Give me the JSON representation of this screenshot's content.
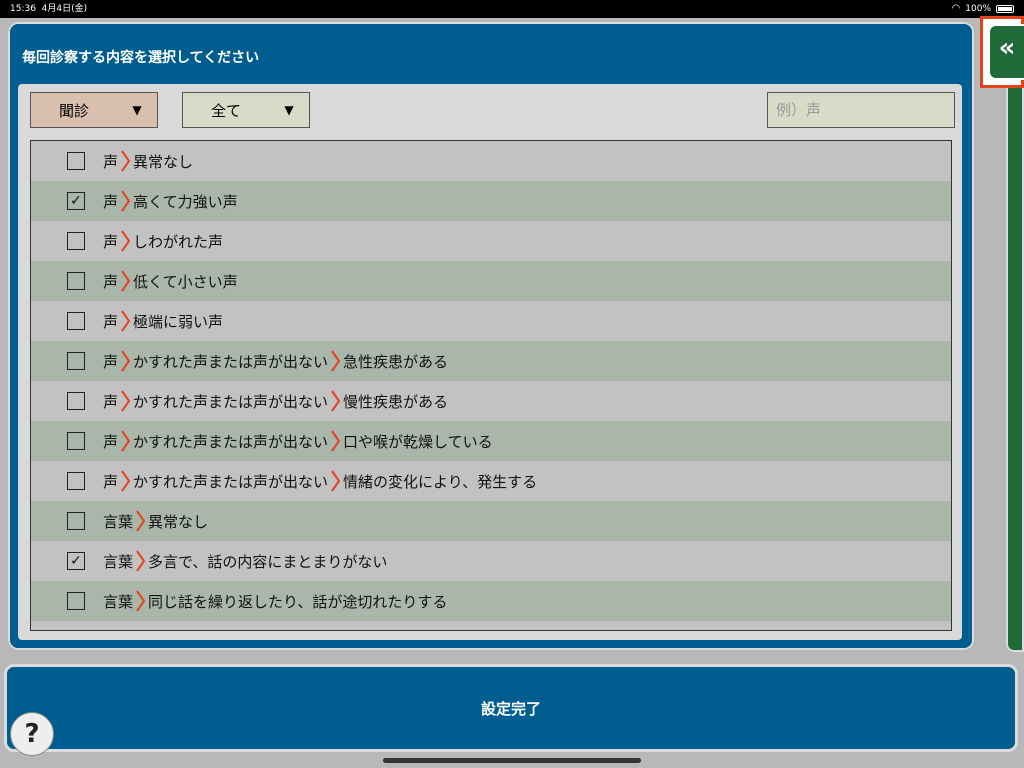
{
  "status": {
    "time": "15:36",
    "date": "4月4日(金)",
    "battery": "100%"
  },
  "panel": {
    "title": "毎回診察する内容を選択してください",
    "category_filter": "聞診",
    "scope_filter": "全て",
    "search_placeholder": "例）声"
  },
  "rows": [
    {
      "checked": false,
      "parts": [
        "声",
        "異常なし"
      ]
    },
    {
      "checked": true,
      "parts": [
        "声",
        "高くて力強い声"
      ]
    },
    {
      "checked": false,
      "parts": [
        "声",
        "しわがれた声"
      ]
    },
    {
      "checked": false,
      "parts": [
        "声",
        "低くて小さい声"
      ]
    },
    {
      "checked": false,
      "parts": [
        "声",
        "極端に弱い声"
      ]
    },
    {
      "checked": false,
      "parts": [
        "声",
        "かすれた声または声が出ない",
        "急性疾患がある"
      ]
    },
    {
      "checked": false,
      "parts": [
        "声",
        "かすれた声または声が出ない",
        "慢性疾患がある"
      ]
    },
    {
      "checked": false,
      "parts": [
        "声",
        "かすれた声または声が出ない",
        "口や喉が乾燥している"
      ]
    },
    {
      "checked": false,
      "parts": [
        "声",
        "かすれた声または声が出ない",
        "情緒の変化により、発生する"
      ]
    },
    {
      "checked": false,
      "parts": [
        "言葉",
        "異常なし"
      ]
    },
    {
      "checked": true,
      "parts": [
        "言葉",
        "多言で、話の内容にまとまりがない"
      ]
    },
    {
      "checked": false,
      "parts": [
        "言葉",
        "同じ話を繰り返したり、話が途切れたりする"
      ]
    }
  ],
  "side": {
    "collapse_icon": "«"
  },
  "footer": {
    "done_label": "設定完了",
    "help_label": "?"
  },
  "colors": {
    "panel": "#005d8f",
    "accent": "#e5421c",
    "green": "#1f6a38"
  }
}
